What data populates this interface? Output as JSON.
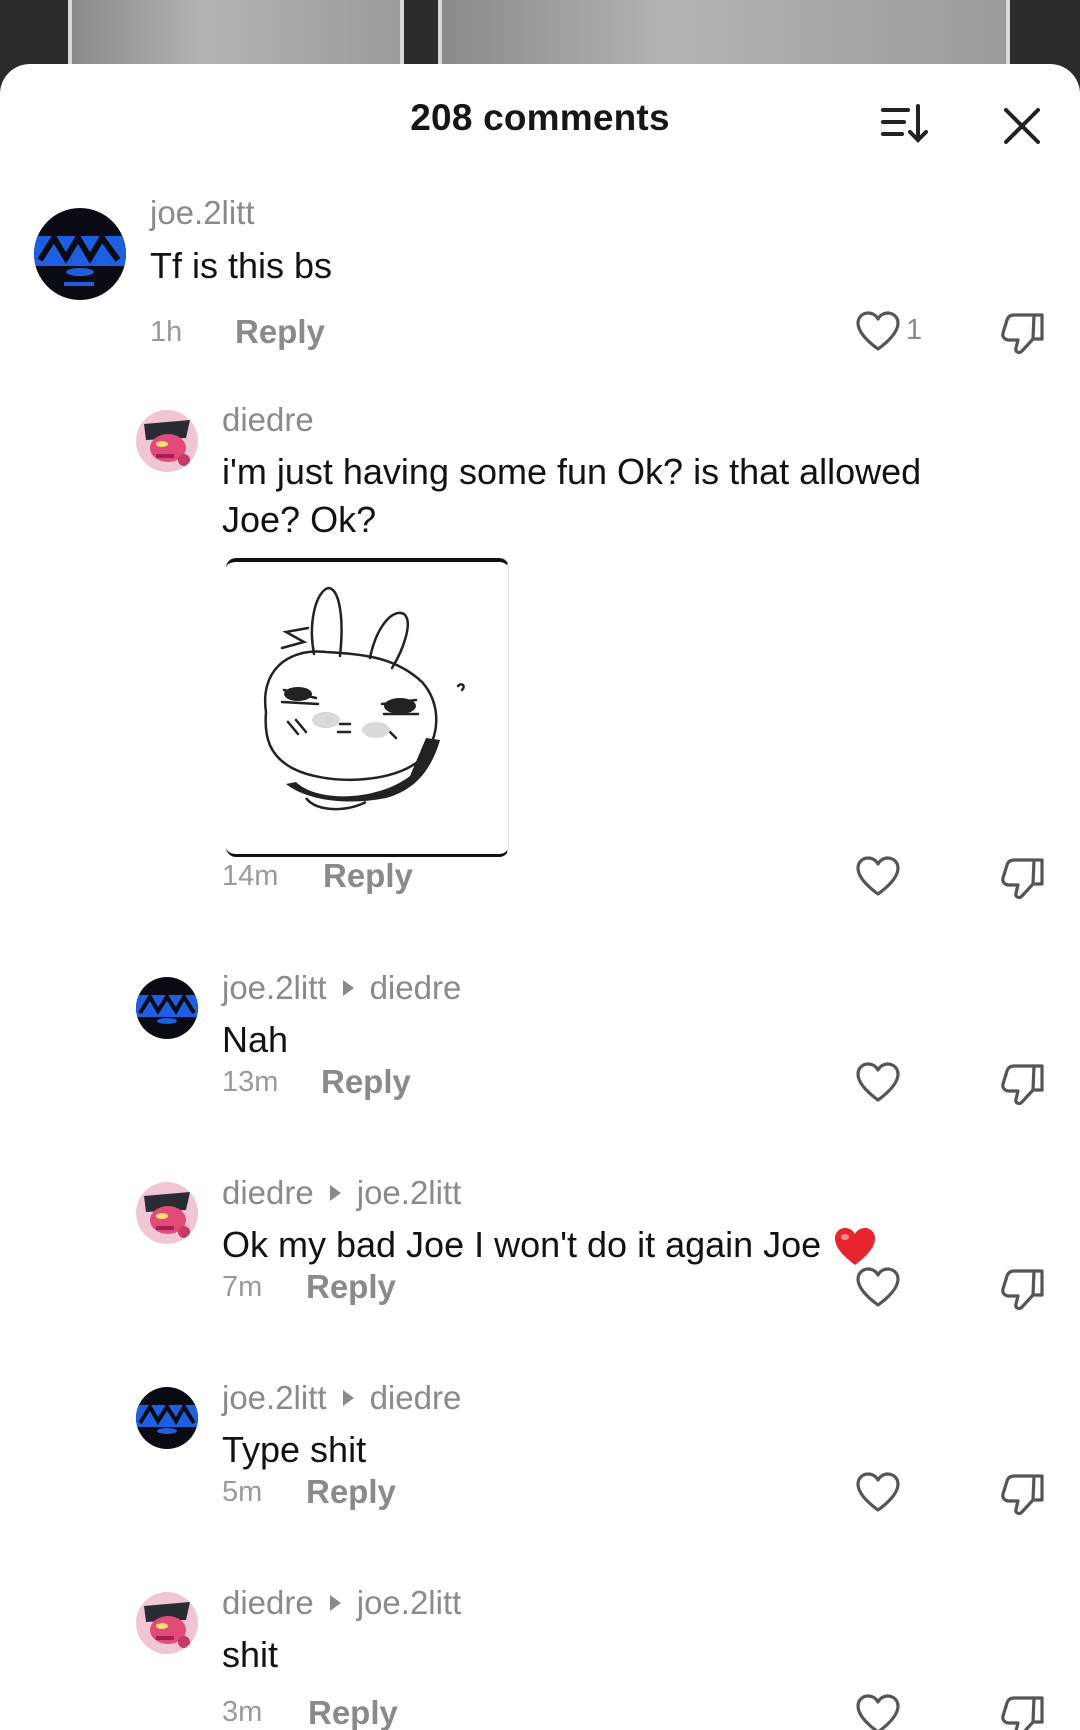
{
  "header": {
    "title": "208 comments",
    "sort_icon": "sort-icon",
    "close_icon": "close-icon"
  },
  "comments": [
    {
      "username": "joe.2litt",
      "text": "Tf is this bs",
      "time": "1h",
      "reply_label": "Reply",
      "like_count": "1"
    },
    {
      "username": "diedre",
      "text_line1": "i'm just having some fun Ok? is that allowed",
      "text_line2": "Joe? Ok?",
      "has_sticker": true,
      "time": "14m",
      "reply_label": "Reply"
    },
    {
      "username": "joe.2litt",
      "reply_to": "diedre",
      "text": "Nah",
      "time": "13m",
      "reply_label": "Reply"
    },
    {
      "username": "diedre",
      "reply_to": "joe.2litt",
      "text": "Ok my bad Joe I won't do it again Joe",
      "emoji": "red-heart",
      "time": "7m",
      "reply_label": "Reply"
    },
    {
      "username": "joe.2litt",
      "reply_to": "diedre",
      "text": "Type shit",
      "time": "5m",
      "reply_label": "Reply"
    },
    {
      "username": "diedre",
      "reply_to": "joe.2litt",
      "text": "shit",
      "time": "3m",
      "reply_label": "Reply"
    }
  ],
  "colors": {
    "sheet_bg": "#ffffff",
    "muted_text": "#8a8a8a",
    "primary_text": "#121212",
    "joe_avatar_blue": "#1d5fe0",
    "heart_red": "#e8242f"
  }
}
